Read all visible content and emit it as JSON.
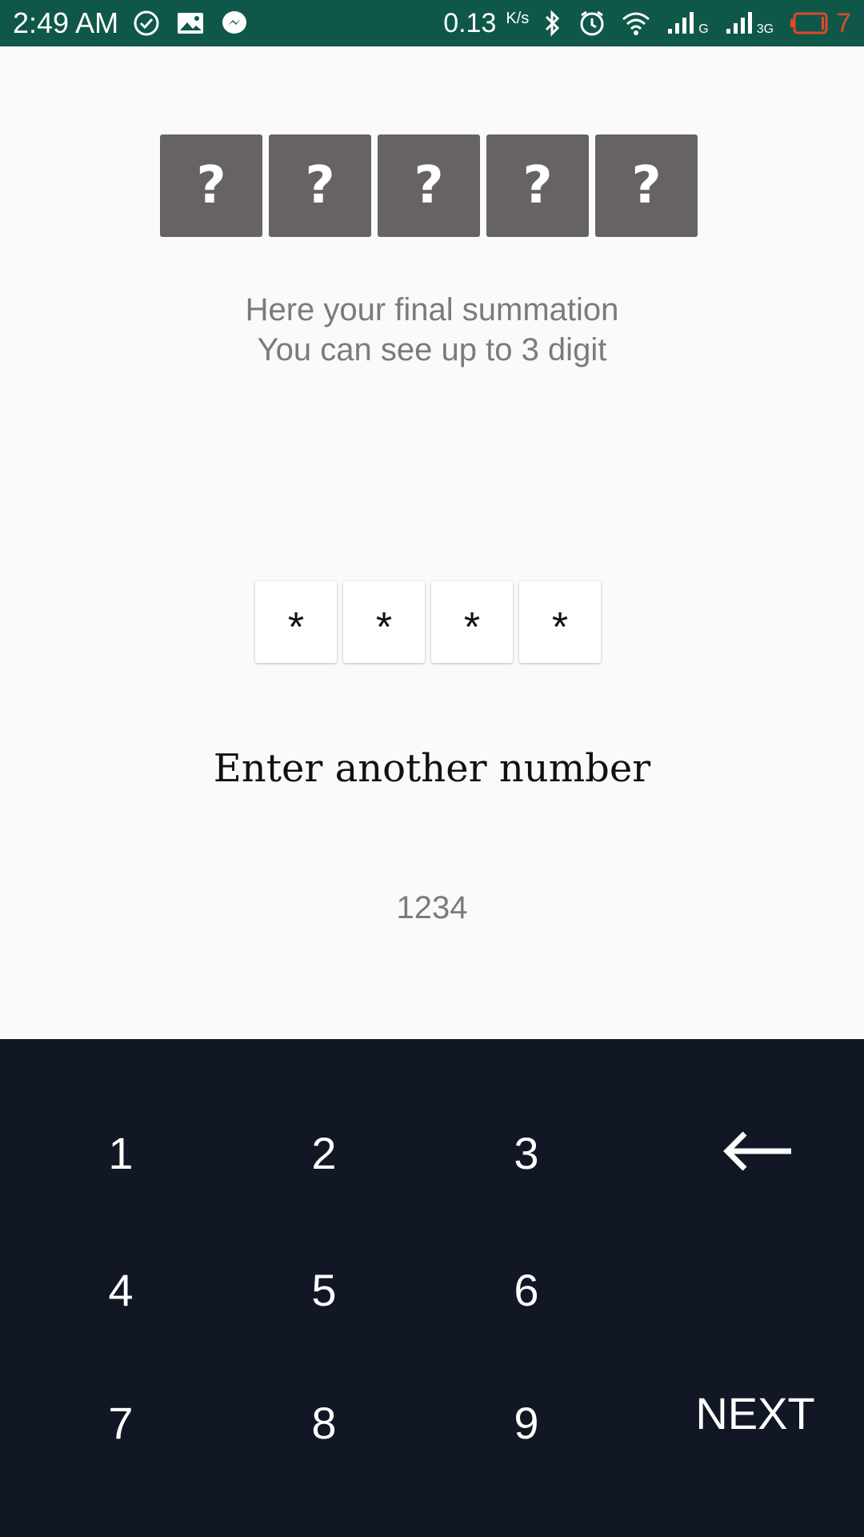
{
  "status_bar": {
    "time": "2:49 AM",
    "speed": "0.13",
    "speed_unit": "K/s",
    "network_g": "G",
    "network_3g": "3G",
    "battery": "7",
    "battery_color": "#e0492b",
    "background": "#0f5849",
    "icons": [
      "check-circle-icon",
      "gallery-icon",
      "messenger-icon",
      "bluetooth-icon",
      "alarm-icon",
      "wifi-icon",
      "signal-icon",
      "signal-icon",
      "battery-icon"
    ]
  },
  "tiles": [
    "?",
    "?",
    "?",
    "?",
    "?"
  ],
  "info": {
    "line1": "Here your final summation",
    "line2": "You can see up to 3 digit"
  },
  "pin": [
    "*",
    "*",
    "*",
    "*"
  ],
  "prompt": "Enter another number",
  "entered_value": "1234",
  "keypad": {
    "background": "#121725",
    "keys": [
      "1",
      "2",
      "3",
      "4",
      "5",
      "6",
      "7",
      "8",
      "9"
    ],
    "backspace_icon": "arrow-left-icon",
    "next_label": "NEXT"
  }
}
